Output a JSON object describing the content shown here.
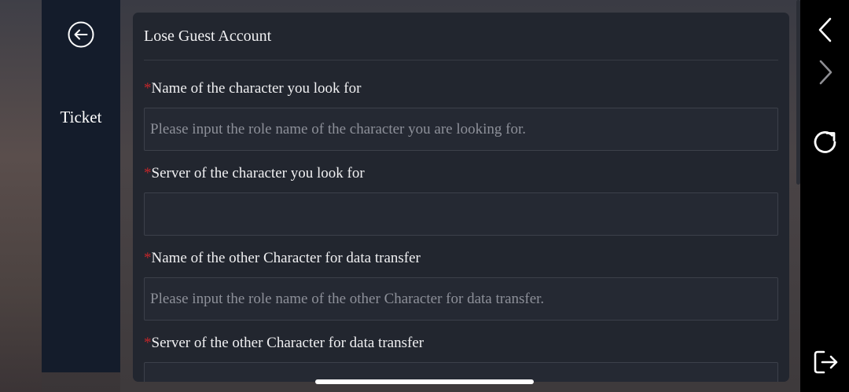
{
  "sidebar": {
    "back_icon": "circle-arrow-left-icon",
    "items": [
      {
        "label": "Ticket"
      }
    ]
  },
  "form": {
    "title": "Lose Guest Account",
    "required_mark": "*",
    "fields": [
      {
        "label": "Name of the character you look for",
        "value": "",
        "placeholder": "Please input the role name of the character you are looking for."
      },
      {
        "label": "Server of the character you look for",
        "value": "",
        "placeholder": ""
      },
      {
        "label": "Name of the other Character for data transfer",
        "value": "",
        "placeholder": "Please input the role name of the other Character for data transfer."
      },
      {
        "label": "Server of the other Character for data transfer",
        "value": "",
        "placeholder": ""
      }
    ]
  },
  "nav": {
    "icons": [
      "chevron-left-icon",
      "chevron-right-icon",
      "refresh-icon",
      "exit-icon"
    ]
  },
  "colors": {
    "sidebar_bg": "#141c2b",
    "panel_bg": "#22262f",
    "input_bg": "#252933",
    "required_red": "#c0262a",
    "nav_bg": "#000000"
  }
}
